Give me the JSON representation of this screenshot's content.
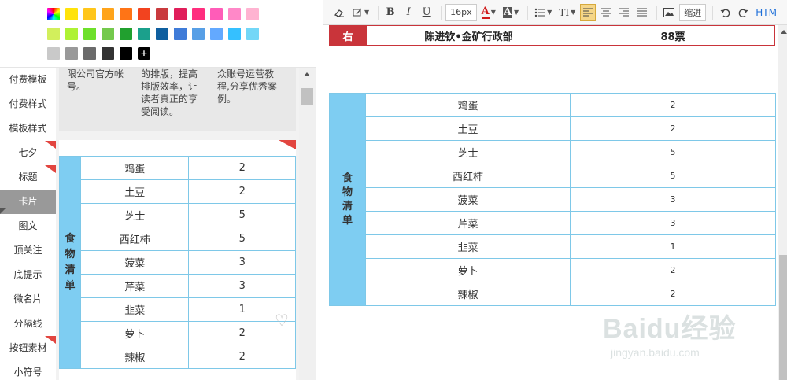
{
  "palette": {
    "row1": [
      "rainbow",
      "#ffe30a",
      "#ffc61a",
      "#ffa41b",
      "#ff7416",
      "#f2431f",
      "#c93a3e",
      "#e01e5a",
      "#ff2e7e",
      "#ff5cb8",
      "#ff88c8",
      "#ffb3d1"
    ],
    "row2": [
      "#d2ef5c",
      "#aef234",
      "#6ee02a",
      "#74c94c",
      "#21a02f",
      "#1ba08c",
      "#0f5f9f",
      "#3f7bd8",
      "#579fe6",
      "#63a9ff",
      "#35c0ff",
      "#73d7f7"
    ],
    "row3": [
      "#c9c9c9",
      "#999999",
      "#6b6b6b",
      "#333333",
      "#000000",
      "plus"
    ],
    "plus_label": "+"
  },
  "sidebar": {
    "items": [
      {
        "label": "付费模板",
        "flag": false,
        "active": false
      },
      {
        "label": "付费样式",
        "flag": false,
        "active": false
      },
      {
        "label": "模板样式",
        "flag": false,
        "active": false
      },
      {
        "label": "七夕",
        "flag": true,
        "active": false
      },
      {
        "label": "标题",
        "flag": true,
        "active": false
      },
      {
        "label": "卡片",
        "flag": false,
        "active": true
      },
      {
        "label": "图文",
        "flag": false,
        "active": false
      },
      {
        "label": "顶关注",
        "flag": false,
        "active": false
      },
      {
        "label": "底提示",
        "flag": false,
        "active": false
      },
      {
        "label": "微名片",
        "flag": false,
        "active": false
      },
      {
        "label": "分隔线",
        "flag": false,
        "active": false
      },
      {
        "label": "按钮素材",
        "flag": true,
        "active": false
      },
      {
        "label": "小符号",
        "flag": false,
        "active": false
      }
    ]
  },
  "cards": {
    "col1": [
      "限公司官方帐",
      "号。"
    ],
    "col2": [
      "的排版，提高",
      "排版效率，让",
      "读者真正的享",
      "受阅读。"
    ],
    "col3": [
      "众账号运营教",
      "程,分享优秀案",
      "例。"
    ]
  },
  "food": {
    "label_chars": [
      "食",
      "物",
      "清",
      "单"
    ],
    "rows": [
      {
        "item": "鸡蛋",
        "qty": "2"
      },
      {
        "item": "土豆",
        "qty": "2"
      },
      {
        "item": "芝士",
        "qty": "5"
      },
      {
        "item": "西红柿",
        "qty": "5"
      },
      {
        "item": "菠菜",
        "qty": "3"
      },
      {
        "item": "芹菜",
        "qty": "3"
      },
      {
        "item": "韭菜",
        "qty": "1"
      },
      {
        "item": "萝卜",
        "qty": "2"
      },
      {
        "item": "辣椒",
        "qty": "2"
      }
    ]
  },
  "toolbar": {
    "font_size": "16px",
    "bold": "B",
    "italic": "I",
    "underline": "U",
    "font_color": "A",
    "bg_color": "A",
    "line_height": "TI",
    "indent": "缩进",
    "html": "HTM"
  },
  "editor": {
    "top_left": "右",
    "top_mid": "陈进钦•金矿行政部",
    "top_right": "88票"
  },
  "watermark": {
    "main": "Baidu经验",
    "sub": "jingyan.baidu.com"
  },
  "colors": {
    "accent_blue": "#7ecdf2",
    "border_blue": "#7ec8e8",
    "flag_red": "#e2453f",
    "header_red": "#c9343a"
  }
}
